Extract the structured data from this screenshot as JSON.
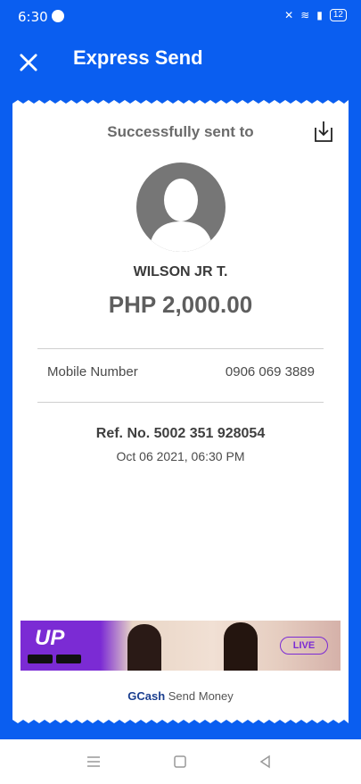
{
  "status": {
    "time": "6:30",
    "battery": "12"
  },
  "header": {
    "title": "Express Send"
  },
  "receipt": {
    "sent_title": "Successfully sent to",
    "recipient_name": "WILSON JR T.",
    "amount": "PHP 2,000.00",
    "mobile_label": "Mobile Number",
    "mobile_value": "0906 069 3889",
    "ref_no": "Ref. No. 5002 351 928054",
    "date": "Oct 06 2021, 06:30 PM"
  },
  "ad": {
    "logo": "UP",
    "live_label": "LIVE"
  },
  "footer": {
    "brand": "GCash",
    "text": "Send Money"
  },
  "colors": {
    "primary": "#0a5ef0",
    "ad_purple": "#7b2bd4"
  },
  "icons": [
    "close-icon",
    "download-icon",
    "avatar-icon",
    "menu-icon",
    "home-icon",
    "back-icon"
  ]
}
